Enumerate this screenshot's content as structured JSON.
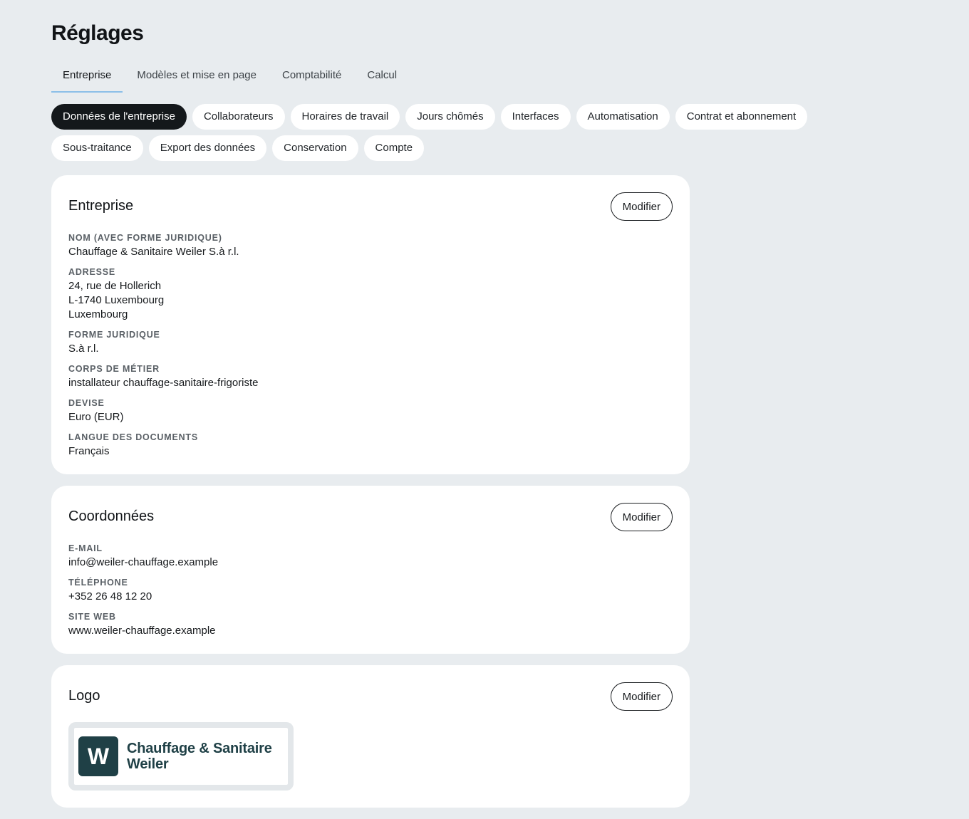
{
  "page": {
    "title": "Réglages"
  },
  "tabs": [
    {
      "label": "Entreprise",
      "active": true
    },
    {
      "label": "Modèles et mise en page",
      "active": false
    },
    {
      "label": "Comptabilité",
      "active": false
    },
    {
      "label": "Calcul",
      "active": false
    }
  ],
  "subnav": {
    "row1": [
      {
        "label": "Données de l'entreprise",
        "active": true
      },
      {
        "label": "Collaborateurs",
        "active": false
      },
      {
        "label": "Horaires de travail",
        "active": false
      },
      {
        "label": "Jours chômés",
        "active": false
      },
      {
        "label": "Interfaces",
        "active": false
      },
      {
        "label": "Automatisation",
        "active": false
      },
      {
        "label": "Contrat et abonnement",
        "active": false
      }
    ],
    "row2": [
      {
        "label": "Sous-traitance",
        "active": false
      },
      {
        "label": "Export des données",
        "active": false
      },
      {
        "label": "Conservation",
        "active": false
      },
      {
        "label": "Compte",
        "active": false
      }
    ]
  },
  "company_card": {
    "title": "Entreprise",
    "edit_label": "Modifier",
    "fields": {
      "name_label": "NOM (AVEC FORME JURIDIQUE)",
      "name_value": "Chauffage & Sanitaire Weiler S.à r.l.",
      "address_label": "ADRESSE",
      "address_line1": "24, rue de Hollerich",
      "address_line2": "L-1740 Luxembourg",
      "address_line3": "Luxembourg",
      "legal_form_label": "FORME JURIDIQUE",
      "legal_form_value": "S.à r.l.",
      "trade_label": "CORPS DE MÉTIER",
      "trade_value": "installateur chauffage-sanitaire-frigoriste",
      "currency_label": "DEVISE",
      "currency_value": "Euro (EUR)",
      "language_label": "LANGUE DES DOCUMENTS",
      "language_value": "Français"
    }
  },
  "contact_card": {
    "title": "Coordonnées",
    "edit_label": "Modifier",
    "fields": {
      "email_label": "E-MAIL",
      "email_value": "info@weiler-chauffage.example",
      "phone_label": "TÉLÉPHONE",
      "phone_value": "+352 26 48 12 20",
      "website_label": "SITE WEB",
      "website_value": "www.weiler-chauffage.example"
    }
  },
  "logo_card": {
    "title": "Logo",
    "edit_label": "Modifier",
    "logo": {
      "mark_letter": "W",
      "name_line1": "Chauffage & Sanitaire",
      "name_line2": "Weiler",
      "brand_color": "#1f4046"
    }
  },
  "colors": {
    "background": "#e8ecef",
    "card": "#ffffff",
    "active_pill": "#14181b",
    "tab_underline": "#8cbfe8"
  }
}
